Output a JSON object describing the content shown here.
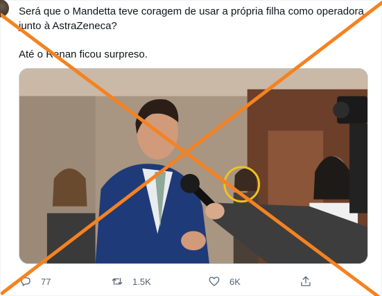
{
  "tweet": {
    "text_line1": "Será que o Mandetta teve coragem de usar a própria filha como operadora",
    "text_line2": "junto à AstraZeneca?",
    "text_line3": "Até o Renan ficou surpreso."
  },
  "actions": {
    "reply_count": "77",
    "retweet_count": "1.5K",
    "like_count": "6K"
  },
  "icons": {
    "reply": "reply-icon",
    "retweet": "retweet-icon",
    "like": "heart-icon",
    "share": "share-icon"
  },
  "colors": {
    "cross_mark": "#f58220",
    "highlight_circle": "#f2c21b",
    "icon_gray": "#536471"
  }
}
